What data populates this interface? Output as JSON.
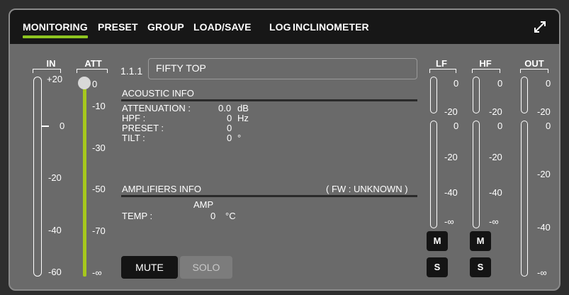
{
  "tabs": [
    {
      "label": "MONITORING",
      "active": true
    },
    {
      "label": "PRESET"
    },
    {
      "label": "GROUP"
    },
    {
      "label": "LOAD/SAVE"
    },
    {
      "label": "LOG"
    },
    {
      "label": "INCLINOMETER"
    }
  ],
  "icons": {
    "expand": "expand-arrows-icon"
  },
  "meters": {
    "in": {
      "label": "IN",
      "scale": [
        "+20",
        "0",
        "-20",
        "-40",
        "-60"
      ]
    },
    "att": {
      "label": "ATT",
      "scale": [
        "0",
        "-10",
        "-30",
        "-50",
        "-70",
        "-∞"
      ],
      "fader_level_db": 0
    },
    "lf": {
      "label": "LF",
      "scale_top": [
        "0",
        "-20"
      ],
      "scale_bottom": [
        "0",
        "-20",
        "-40",
        "-∞"
      ]
    },
    "hf": {
      "label": "HF",
      "scale_top": [
        "0",
        "-20"
      ],
      "scale_bottom": [
        "0",
        "-20",
        "-40",
        "-∞"
      ]
    },
    "out": {
      "label": "OUT",
      "scale": [
        "0",
        "-20",
        "0",
        "-20",
        "-40",
        "-∞"
      ]
    }
  },
  "channel": {
    "id": "1.1.1",
    "name": "FIFTY TOP"
  },
  "acoustic": {
    "title": "ACOUSTIC INFO",
    "rows": [
      {
        "label": "ATTENUATION :",
        "value": "0.0",
        "unit": "dB"
      },
      {
        "label": "HPF :",
        "value": "0",
        "unit": "Hz"
      },
      {
        "label": "PRESET :",
        "value": "0",
        "unit": ""
      },
      {
        "label": "TILT :",
        "value": "0",
        "unit": "°"
      }
    ]
  },
  "amplifiers": {
    "title": "AMPLIFIERS INFO",
    "fw": "( FW : UNKNOWN )",
    "column": "AMP",
    "temp_label": "TEMP :",
    "temp_value": "0",
    "temp_unit": "°C"
  },
  "buttons": {
    "mute": "MUTE",
    "solo": "SOLO",
    "m": "M",
    "s": "S"
  },
  "colors": {
    "accent": "#8ec520",
    "fader": "#a6c81c",
    "panel": "#6a6a6a",
    "tabbar": "#171717"
  }
}
